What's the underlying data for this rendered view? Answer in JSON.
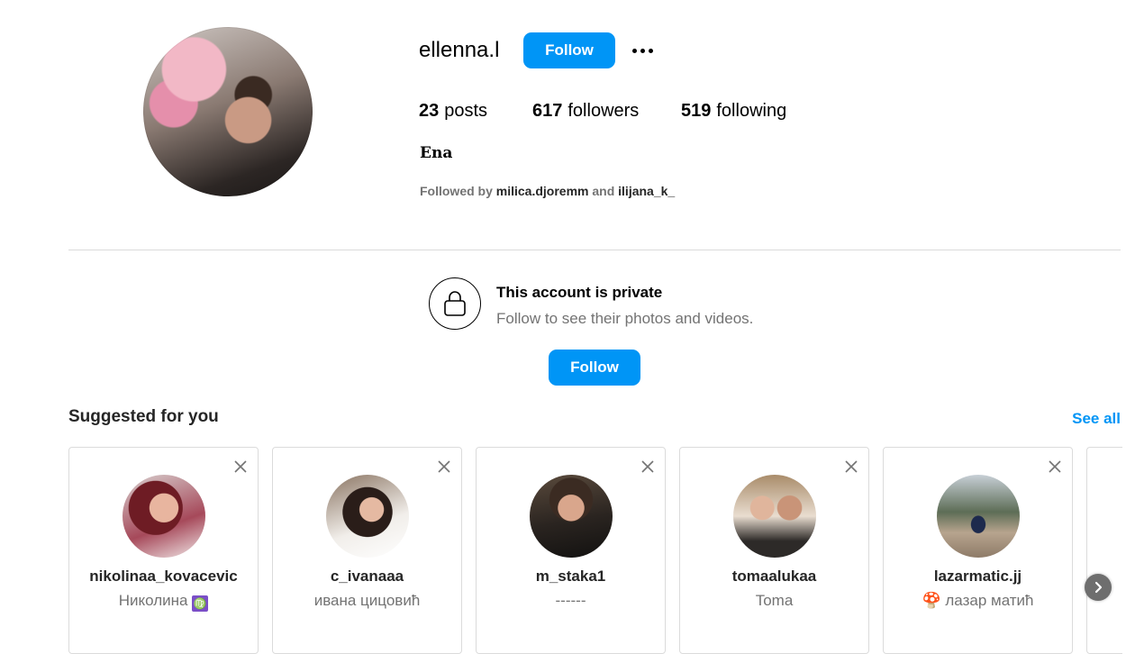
{
  "profile": {
    "username": "ellenna.l",
    "follow_label": "Follow",
    "more_icon": "more-horizontal-icon",
    "posts_count": "23",
    "posts_label": "posts",
    "followers_count": "617",
    "followers_label": "followers",
    "following_count": "519",
    "following_label": "following",
    "full_name": "Ena",
    "followed_by_prefix": "Followed by",
    "followed_by_user1": "milica.djoremm",
    "followed_by_and": "and",
    "followed_by_user2": "ilijana_k_"
  },
  "private_notice": {
    "icon": "lock-icon",
    "title": "This account is private",
    "subtitle": "Follow to see their photos and videos.",
    "follow_label": "Follow"
  },
  "suggested": {
    "title": "Suggested for you",
    "see_all": "See all",
    "cards": [
      {
        "username": "nikolinaa_kovacevic",
        "name": "Николина",
        "emoji": "♍"
      },
      {
        "username": "c_ivanaaa",
        "name": "ивана цицовић",
        "emoji": ""
      },
      {
        "username": "m_staka1",
        "name": "------",
        "emoji": ""
      },
      {
        "username": "tomaalukaa",
        "name": "Toma",
        "emoji": ""
      },
      {
        "username": "lazarmatic.jj",
        "name": "лазар матић",
        "emoji": "🍄"
      }
    ]
  },
  "colors": {
    "accent": "#0095f6",
    "secondary_text": "#737373",
    "border": "#dbdbdb"
  }
}
